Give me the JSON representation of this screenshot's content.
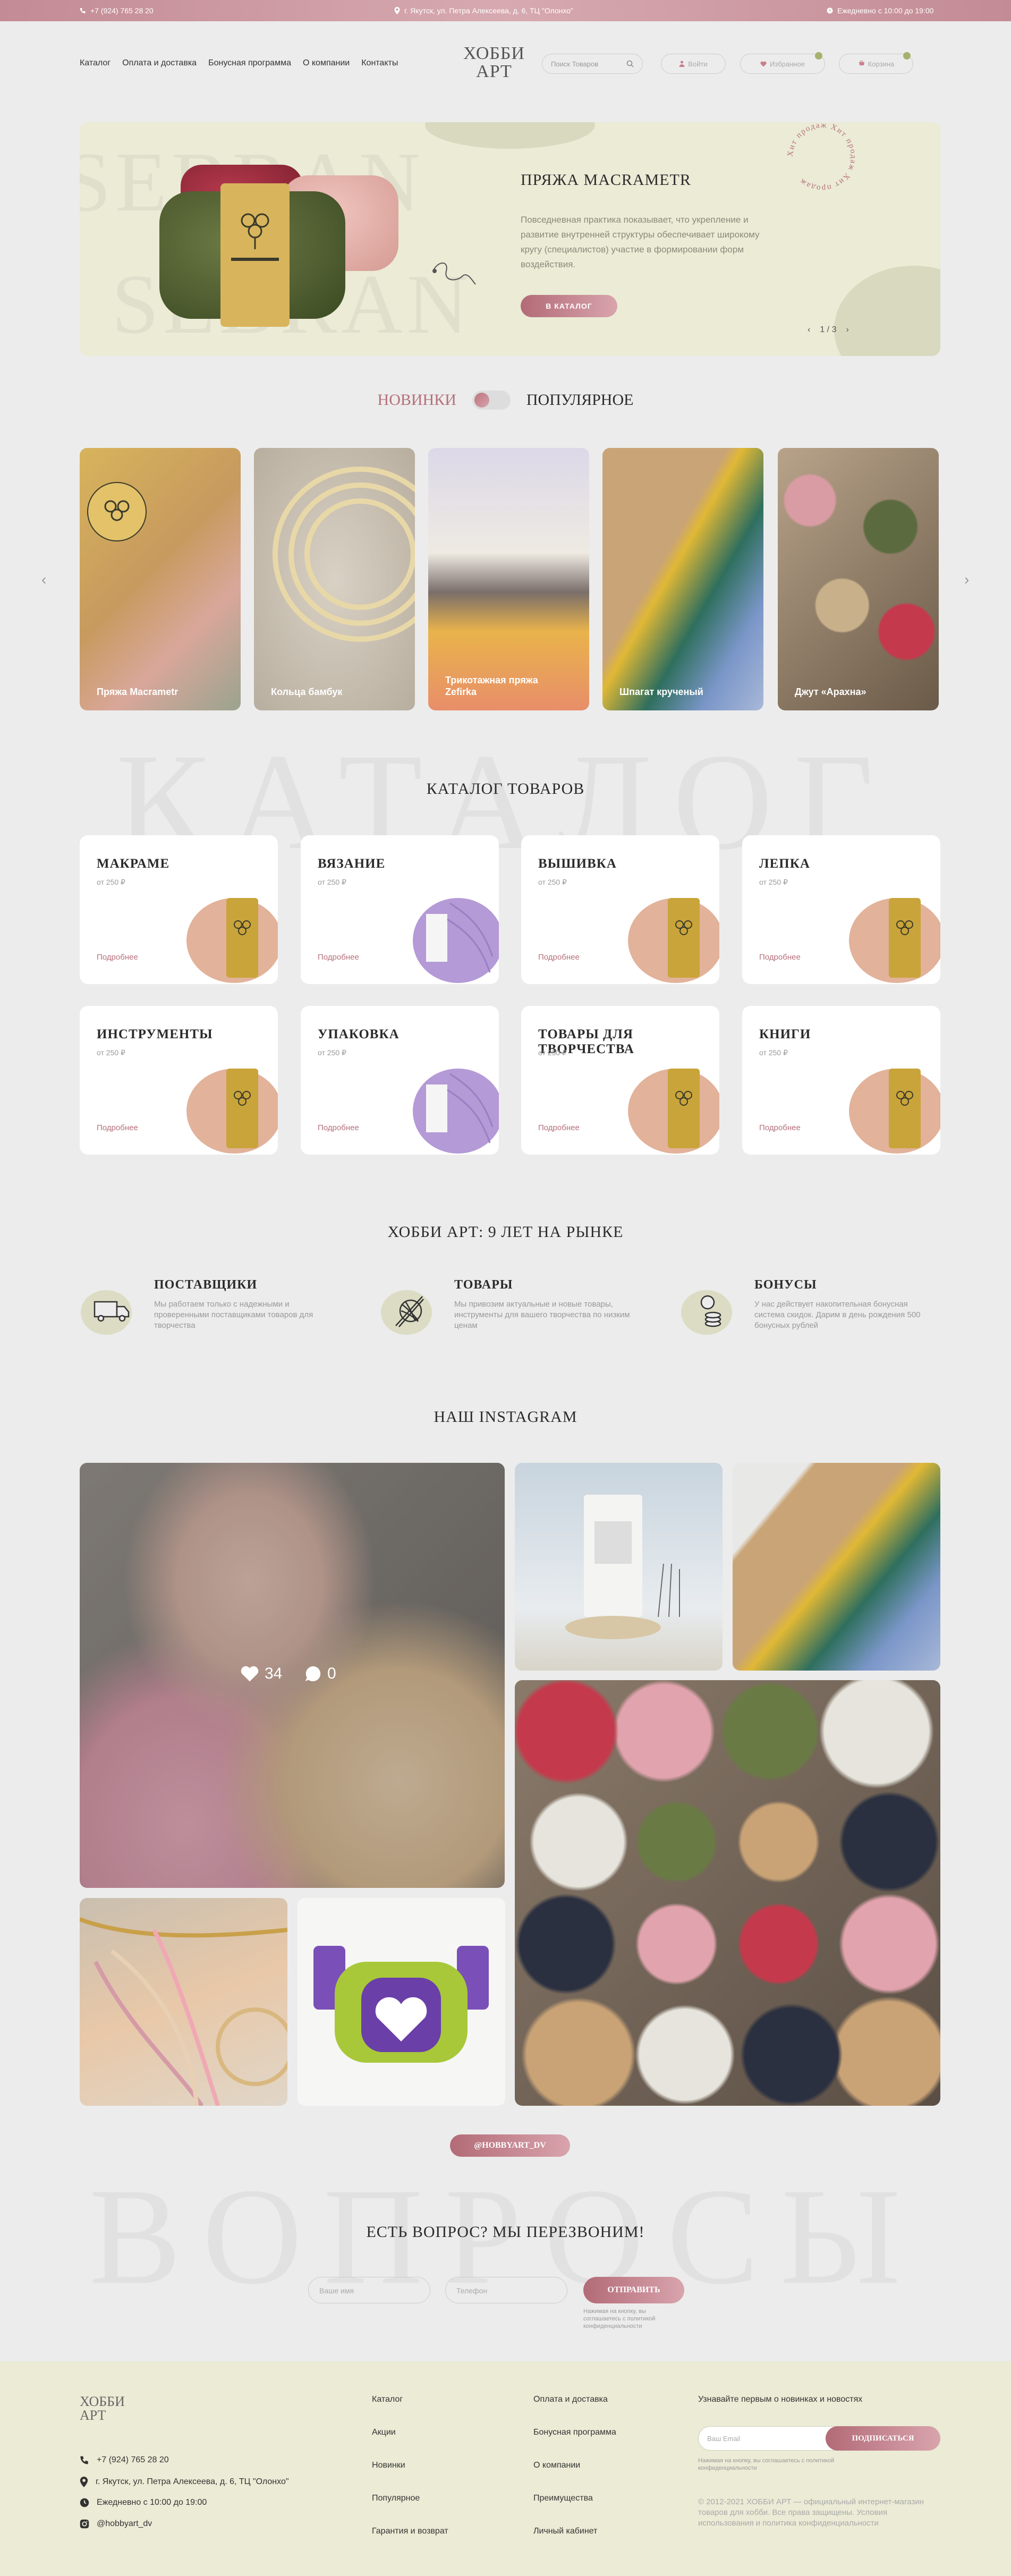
{
  "topbar": {
    "phone": "+7 (924) 765 28 20",
    "address": "г. Якутск, ул. Петра Алексеева, д. 6, ТЦ \"Олонхо\"",
    "hours": "Ежедневно с 10:00 до 19:00"
  },
  "nav": [
    "Каталог",
    "Оплата и доставка",
    "Бонусная программа",
    "О компании",
    "Контакты"
  ],
  "logo": {
    "line1": "ХОББИ",
    "line2": "АРТ"
  },
  "search": {
    "placeholder": "Поиск Товаров"
  },
  "header_buttons": {
    "login": "Войти",
    "favorites": "Избранное",
    "cart": "Корзина"
  },
  "hero": {
    "title": "ПРЯЖА MACRAMETR",
    "description": "Повседневная практика показывает, что укрепление и развитие внутренней структуры обеспечивает широкому кругу (специалистов) участие в формировании форм воздействия.",
    "cta": "В КАТАЛОГ",
    "pager": "1 / 3",
    "badge": "Хит продаж Хит продаж Хит продаж",
    "bg_text": "SEBRAN"
  },
  "toggle": {
    "left": "НОВИНКИ",
    "right": "ПОПУЛЯРНОЕ"
  },
  "products": [
    {
      "label": "Пряжа Macrametr"
    },
    {
      "label": "Кольца бамбук"
    },
    {
      "label": "Трикотажная пряжа Zefirka"
    },
    {
      "label": "Шпагат крученый"
    },
    {
      "label": "Джут «Арахна»"
    }
  ],
  "watermark_catalog": "КАТАЛОГ",
  "catalog": {
    "title": "КАТАЛОГ ТОВАРОВ",
    "items": [
      {
        "name": "МАКРАМЕ",
        "price": "от 250 ₽",
        "more": "Подробнее"
      },
      {
        "name": "ВЯЗАНИЕ",
        "price": "от 250 ₽",
        "more": "Подробнее"
      },
      {
        "name": "ВЫШИВКА",
        "price": "от 250 ₽",
        "more": "Подробнее"
      },
      {
        "name": "ЛЕПКА",
        "price": "от 250 ₽",
        "more": "Подробнее"
      },
      {
        "name": "ИНСТРУМЕНТЫ",
        "price": "от 250 ₽",
        "more": "Подробнее"
      },
      {
        "name": "УПАКОВКА",
        "price": "от 250 ₽",
        "more": "Подробнее"
      },
      {
        "name": "ТОВАРЫ ДЛЯ ТВОРЧЕСТВА",
        "price": "от 250 ₽",
        "more": "Подробнее"
      },
      {
        "name": "КНИГИ",
        "price": "от 250 ₽",
        "more": "Подробнее"
      }
    ]
  },
  "about": {
    "title": "ХОББИ АРТ: 9 ЛЕТ НА РЫНКЕ",
    "features": [
      {
        "title": "ПОСТАВЩИКИ",
        "text": "Мы работаем только с надежными и проверенными поставщиками товаров для творчества",
        "icon": "truck-icon"
      },
      {
        "title": "ТОВАРЫ",
        "text": "Мы привозим актуальные и новые товары, инструменты для вашего творчества по низким ценам",
        "icon": "yarn-icon"
      },
      {
        "title": "БОНУСЫ",
        "text": "У нас действует накопительная бонусная система скидок. Дарим в день рождения 500 бонусных рублей",
        "icon": "coins-icon"
      }
    ]
  },
  "instagram": {
    "title": "НАШ INSTAGRAM",
    "likes": "34",
    "comments": "0",
    "handle": "@HOBBYART_DV"
  },
  "watermark_questions": "ВОПРОСЫ",
  "callback": {
    "title": "ЕСТЬ ВОПРОС? МЫ ПЕРЕЗВОНИМ!",
    "name_placeholder": "Ваше имя",
    "phone_placeholder": "Телефон",
    "button": "ОТПРАВИТЬ",
    "consent": "Нажимая на кнопку, вы соглашаетесь с политикой конфиденциальности"
  },
  "footer": {
    "phone": "+7 (924) 765 28 20",
    "address": "г. Якутск, ул. Петра Алексеева, д. 6, ТЦ \"Олонхо\"",
    "hours": "Ежедневно с 10:00 до 19:00",
    "instagram": "@hobbyart_dv",
    "col1": [
      "Каталог",
      "Акции",
      "Новинки",
      "Популярное",
      "Гарантия и возврат"
    ],
    "col2": [
      "Оплата и доставка",
      "Бонусная программа",
      "О компании",
      "Преимущества",
      "Личный кабинет"
    ],
    "newsletter_title": "Узнавайте первым о новинках и новостях",
    "email_placeholder": "Ваш Email",
    "subscribe": "ПОДПИСАТЬСЯ",
    "newsletter_consent": "Нажимая на кнопку, вы соглашаетесь с политикой конфиденциальности",
    "copyright": "© 2012-2021 ХОББИ АРТ — официальный интернет-магазин товаров для хобби. Все права защищены. Условия использования и политика конфиденциальности"
  }
}
